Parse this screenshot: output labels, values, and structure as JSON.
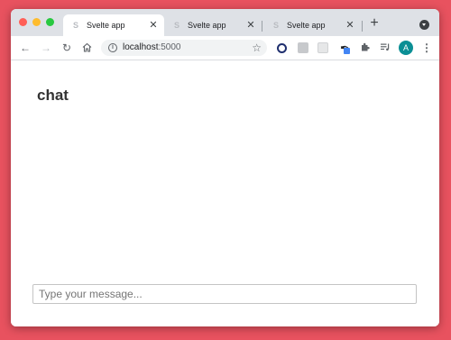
{
  "browser": {
    "tabs": [
      {
        "label": "Svelte app",
        "active": true,
        "favicon": "svelte-icon"
      },
      {
        "label": "Svelte app",
        "active": false,
        "favicon": "svelte-icon"
      },
      {
        "label": "Svelte app",
        "active": false,
        "favicon": "svelte-icon"
      }
    ],
    "close_glyph": "✕",
    "new_tab_glyph": "+",
    "address": {
      "host": "localhost",
      "port": ":5000"
    },
    "avatar_letter": "A",
    "colors": {
      "background": "#e8525f",
      "tab_strip": "#dee1e6",
      "avatar": "#0b8f95",
      "extension_badge": "#4285f4"
    }
  },
  "page": {
    "title": "chat",
    "message_input": {
      "placeholder": "Type your message...",
      "value": ""
    }
  }
}
